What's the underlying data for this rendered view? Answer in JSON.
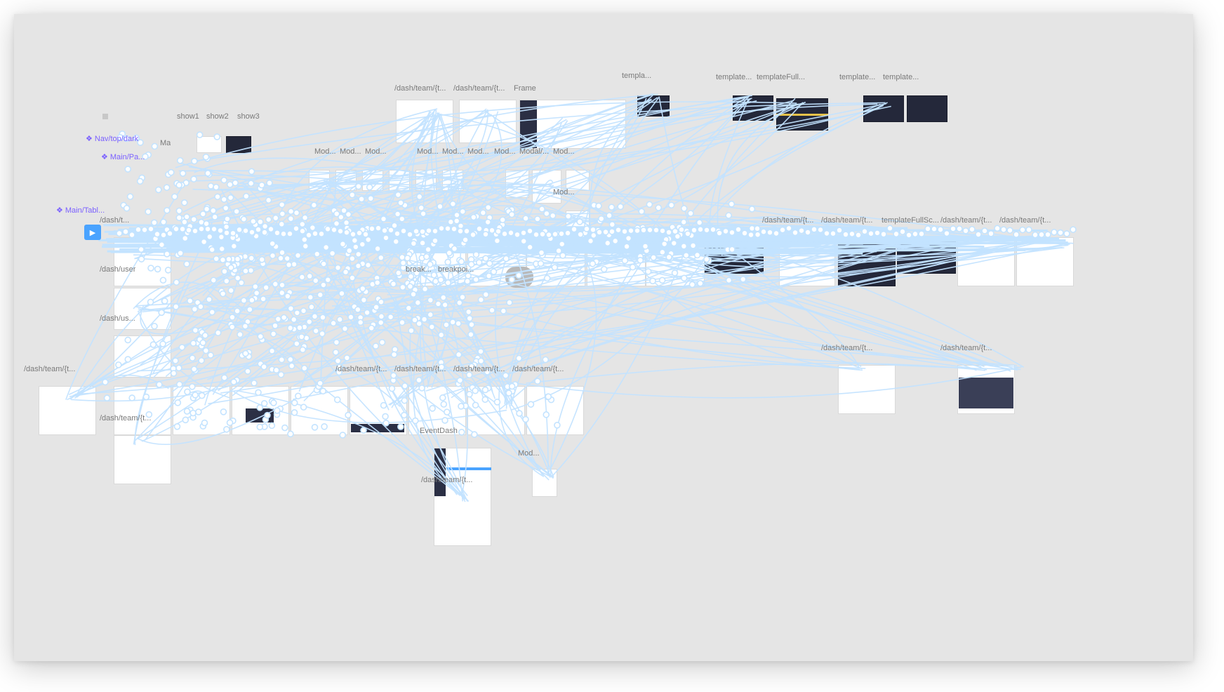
{
  "canvas": {
    "background": "#e5e5e5",
    "connector_color": "#c3e3ff",
    "component_color": "#7b61ff"
  },
  "components": {
    "nav_top_dark": "Nav/top/dark",
    "main_pa": "Main/Pa...",
    "main_tabl": "Main/Tabl...",
    "ma": "Ma"
  },
  "frames": {
    "show1": "show1",
    "show2": "show2",
    "show3": "show3",
    "dash_team_a": "/dash/team/{t...",
    "dash_team_b": "/dash/team/{t...",
    "frame": "Frame",
    "templa": "templa...",
    "template_a": "template...",
    "template_full": "templateFull...",
    "template_b": "template...",
    "template_c": "template...",
    "mod_1": "Mod...",
    "mod_2": "Mod...",
    "mod_3": "Mod...",
    "mod_4": "Mod...",
    "mod_5": "Mod...",
    "mod_6": "Mod...",
    "mod_7": "Mod...",
    "modal": "Modal/...",
    "mod_8": "Mod...",
    "mod_9": "Mod...",
    "dash_t": "/dash/t...",
    "dash_user": "/dash/user",
    "dash_us": "/dash/us...",
    "break": "break...",
    "breakpoi": "breakpoi...",
    "dash_team_r1": "/dash/team/{t...",
    "dash_team_r2": "/dash/team/{t...",
    "template_full_sc": "templateFullSc...",
    "dash_team_r3": "/dash/team/{t...",
    "dash_team_r4": "/dash/team/{t...",
    "dash_team_r5": "/dash/team/{t...",
    "dash_team_r6": "/dash/team/{t...",
    "dash_team_b1": "/dash/team/{t...",
    "dash_team_b2": "/dash/team/{t...",
    "dash_team_b3": "/dash/team/{t...",
    "dash_team_b4": "/dash/team/{t...",
    "dash_team_b5": "/dash/team/{t...",
    "dash_team_b6": "/dash/team/{t...",
    "event_dash": "EventDash",
    "dash_team_e": "/dash/team/{t...",
    "mod_bottom": "Mod..."
  }
}
